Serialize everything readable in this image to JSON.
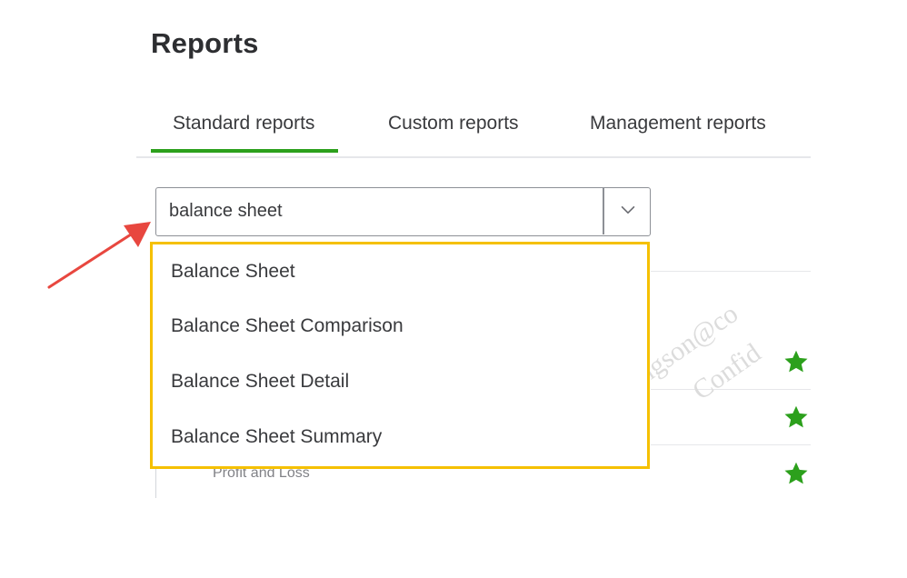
{
  "page": {
    "title": "Reports"
  },
  "tabs": [
    {
      "label": "Standard reports",
      "active": true
    },
    {
      "label": "Custom reports",
      "active": false
    },
    {
      "label": "Management reports",
      "active": false
    }
  ],
  "search": {
    "value": "balance sheet"
  },
  "dropdown": {
    "options": [
      "Balance Sheet",
      "Balance Sheet Comparison",
      "Balance Sheet Detail",
      "Balance Sheet Summary"
    ]
  },
  "background_list": {
    "partial_row_label": "Profit and Loss",
    "favorite_icon": "star-icon",
    "favorite_count": 3
  },
  "watermark": {
    "text_line_1": "ngson@co",
    "text_line_2": "Confid"
  },
  "colors": {
    "accent_green": "#2ca01c",
    "star_green": "#2ca01c",
    "highlight_yellow": "#f5c000",
    "annotation_red": "#e8473f"
  }
}
